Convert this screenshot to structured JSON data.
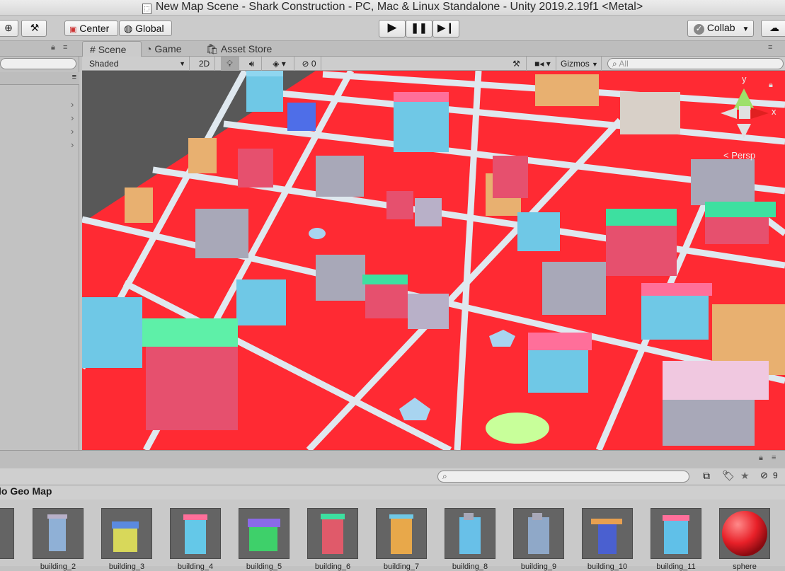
{
  "window": {
    "title": "New Map Scene - Shark Construction - PC, Mac & Linux Standalone - Unity 2019.2.19f1 <Metal>"
  },
  "toolbar": {
    "center_label": "Center",
    "global_label": "Global",
    "collab_label": "Collab"
  },
  "tabs": [
    {
      "label": "Scene",
      "icon": "hash-icon"
    },
    {
      "label": "Game",
      "icon": "pacman-icon"
    },
    {
      "label": "Asset Store",
      "icon": "shopping-bag-icon"
    }
  ],
  "scenebar": {
    "shading_mode": "Shaded",
    "mode_2d": "2D",
    "hidden_count": "0",
    "gizmos_label": "Gizmos",
    "search_placeholder": "All"
  },
  "gizmo": {
    "y_label": "y",
    "x_label": "x",
    "projection": "< Persp"
  },
  "project": {
    "folder_title": "lo Geo Map",
    "visible_count": "9",
    "assets": [
      {
        "name": "building_2",
        "color": "#8fb0d6"
      },
      {
        "name": "building_3",
        "color": "#d8d85a"
      },
      {
        "name": "building_4",
        "color": "#64c8e8"
      },
      {
        "name": "building_5",
        "color": "#3ed06a"
      },
      {
        "name": "building_6",
        "color": "#e05a6a"
      },
      {
        "name": "building_7",
        "color": "#e8a84a"
      },
      {
        "name": "building_8",
        "color": "#68c0e8"
      },
      {
        "name": "building_9",
        "color": "#8fa8c8"
      },
      {
        "name": "building_10",
        "color": "#4a60d0"
      },
      {
        "name": "building_11",
        "color": "#60c0e8"
      },
      {
        "name": "sphere",
        "color": "#e82028"
      }
    ]
  },
  "colors": {
    "ground": "#ff2a33",
    "road": "#dfe8ef",
    "sky": "#585858"
  }
}
